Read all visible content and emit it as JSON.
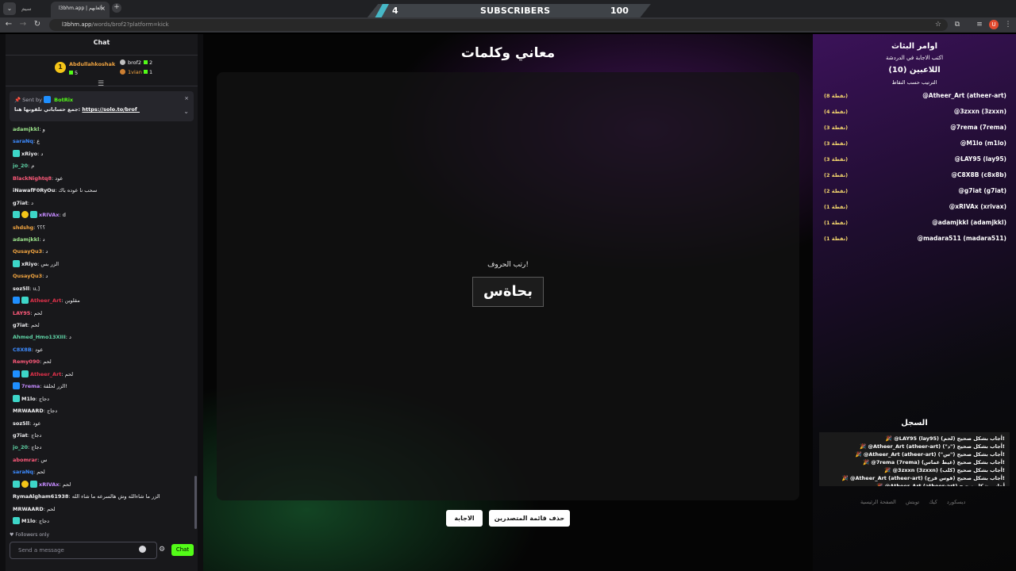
{
  "browser": {
    "tab_inactive": "سيم",
    "tab_active": "l3bhm.app | ألعابهم",
    "tab_close": "×",
    "new_tab": "+",
    "url_host": "l3bhm.app",
    "url_path": "/words/brof2?platform=kick"
  },
  "overlay": {
    "count": "4",
    "label": "SUBSCRIBERS",
    "goal": "100"
  },
  "chat": {
    "header": "Chat",
    "gifters": [
      {
        "rank": "1",
        "name": "Abdullahkoshak",
        "value": "5"
      },
      {
        "name": "brof2",
        "value": "2"
      },
      {
        "name": "1vian",
        "value": "1"
      }
    ],
    "pinned": {
      "sent_by": "Sent by",
      "bot": "BotRix",
      "text": "جمع حساباتي تلقونها هنا:",
      "link": "https://solo.to/brof_"
    },
    "messages": [
      {
        "user": "adamjkkl",
        "color": "#9be38a",
        "text": "و",
        "badges": []
      },
      {
        "user": "saraNq",
        "color": "#3d8bff",
        "text": "ع",
        "badges": []
      },
      {
        "user": "xRiyo",
        "color": "#efeff1",
        "text": "د",
        "badges": [
          "sub"
        ]
      },
      {
        "user": "jo_20",
        "color": "#5fd3a6",
        "text": "م",
        "badges": []
      },
      {
        "user": "BlackNightq8",
        "color": "#ff5a7a",
        "text": "عود",
        "badges": []
      },
      {
        "user": "iNawafF0RyOu",
        "color": "#efeff1",
        "text": "سحب نا عوده باك",
        "badges": []
      },
      {
        "user": "g7iat",
        "color": "#efeff1",
        "text": "د",
        "badges": []
      },
      {
        "user": "xRIVAx",
        "color": "#c58bff",
        "text": "d",
        "badges": [
          "sub",
          "gift",
          "sub"
        ]
      },
      {
        "user": "shdshg",
        "color": "#f2a541",
        "text": "؟؟؟",
        "badges": []
      },
      {
        "user": "adamjkkl",
        "color": "#9be38a",
        "text": "د",
        "badges": []
      },
      {
        "user": "QusayQu3",
        "color": "#f2a541",
        "text": "د",
        "badges": []
      },
      {
        "user": "xRiyo",
        "color": "#efeff1",
        "text": "الزر بس",
        "badges": [
          "sub"
        ]
      },
      {
        "user": "QusayQu3",
        "color": "#f2a541",
        "text": "د",
        "badges": []
      },
      {
        "user": "soz5ll",
        "color": "#efeff1",
        "text": "u,]",
        "badges": []
      },
      {
        "user": "Atheer_Art",
        "color": "#e0314a",
        "text": "مقلوبن",
        "badges": [
          "mod",
          "sub"
        ]
      },
      {
        "user": "LAY95",
        "color": "#ff5a7a",
        "text": "لحم",
        "badges": []
      },
      {
        "user": "g7iat",
        "color": "#efeff1",
        "text": "لحم",
        "badges": []
      },
      {
        "user": "Ahmed_Hmo13XIII",
        "color": "#5fd3a6",
        "text": "د",
        "badges": []
      },
      {
        "user": "C8X8B",
        "color": "#3d8bff",
        "text": "عود",
        "badges": []
      },
      {
        "user": "Remy090",
        "color": "#ff5a7a",
        "text": "لحم",
        "badges": []
      },
      {
        "user": "Atheer_Art",
        "color": "#e0314a",
        "text": "لحم",
        "badges": [
          "mod",
          "sub"
        ]
      },
      {
        "user": "7rema",
        "color": "#c58bff",
        "text": "الزر لحلقة!",
        "badges": [
          "mod"
        ]
      },
      {
        "user": "M1lo",
        "color": "#efeff1",
        "text": "دجاج",
        "badges": [
          "sub"
        ]
      },
      {
        "user": "MRWAARD",
        "color": "#efeff1",
        "text": "دجاج",
        "badges": []
      },
      {
        "user": "soz5ll",
        "color": "#efeff1",
        "text": "عود",
        "badges": []
      },
      {
        "user": "g7iat",
        "color": "#efeff1",
        "text": "دجاج",
        "badges": []
      },
      {
        "user": "jo_20",
        "color": "#5fd3a6",
        "text": "دجاج",
        "badges": []
      },
      {
        "user": "abomrar",
        "color": "#ff5a7a",
        "text": "س",
        "badges": []
      },
      {
        "user": "saraNq",
        "color": "#3d8bff",
        "text": "لحم",
        "badges": []
      },
      {
        "user": "xRIVAx",
        "color": "#c58bff",
        "text": "لحم",
        "badges": [
          "sub",
          "gift",
          "sub"
        ]
      },
      {
        "user": "RymaAlgham61938",
        "color": "#efeff1",
        "text": "الزر ما شاءالله وش هالسرعه ما شاء الله",
        "badges": []
      },
      {
        "user": "MRWAARD",
        "color": "#efeff1",
        "text": "لحم",
        "badges": []
      },
      {
        "user": "M1lo",
        "color": "#efeff1",
        "text": "دجاج",
        "badges": [
          "sub"
        ]
      }
    ],
    "followers_only": "Followers only",
    "input_placeholder": "Send a message",
    "send_label": "Chat"
  },
  "game": {
    "title": "معاني وكلمات",
    "hint": "رتب الحروف!",
    "scrambled_word": "بحاةس",
    "answer_button": "الاجابة",
    "clear_button": "حذف قائمة المتصدرين"
  },
  "panel": {
    "title": "اوامر البثاث",
    "subtitle": "اكتب الاجابة في الدردشة",
    "players_title": "اللاعبين (10)",
    "sort_note": "الترتيب حسب النقاط",
    "leaderboard": [
      {
        "name": "@Atheer_Art (atheer-art)",
        "points": "(8 نقطة)"
      },
      {
        "name": "@3zxxn (3zxxn)",
        "points": "(4 نقطة)"
      },
      {
        "name": "@7rema (7rema)",
        "points": "(3 نقطة)"
      },
      {
        "name": "@M1lo (m1lo)",
        "points": "(3 نقطة)"
      },
      {
        "name": "@LAY95 (lay95)",
        "points": "(3 نقطة)"
      },
      {
        "name": "@C8X8B (c8x8b)",
        "points": "(2 نقطة)"
      },
      {
        "name": "@g7iat (g7iat)",
        "points": "(2 نقطة)"
      },
      {
        "name": "@xRIVAx (xrivax)",
        "points": "(1 نقطة)"
      },
      {
        "name": "@adamjkkl (adamjkkl)",
        "points": "(1 نقطة)"
      },
      {
        "name": "@madara511 (madara511)",
        "points": "(1 نقطة)"
      }
    ],
    "log_title": "السجل",
    "log": [
      "🎉 @LAY95 (lay95) أجاب بشكل صحيح (لحم)!",
      "🎉 @Atheer_Art (atheer-art) أجاب بشكل صحيح (\"د\")!",
      "🎉 @Atheer_Art (atheer-art) أجاب بشكل صحيح (\"س\")!",
      "🎉 @7rema (7rema) أجاب بشكل صحيح (غيط غماس)!",
      "🎉 @3zxxn (3zxxn) أجاب بشكل صحيح (كلب)!",
      "🎉 @Atheer_Art (atheer-art) أجاب بشكل صحيح (قوس قزح)!",
      "🎉 @Atheer_Art (atheer-art) أجاب بشكل صحيح"
    ],
    "footer": [
      "الصفحة الرئيسية",
      "تويتش",
      "كيك",
      "ديسكورد"
    ]
  }
}
